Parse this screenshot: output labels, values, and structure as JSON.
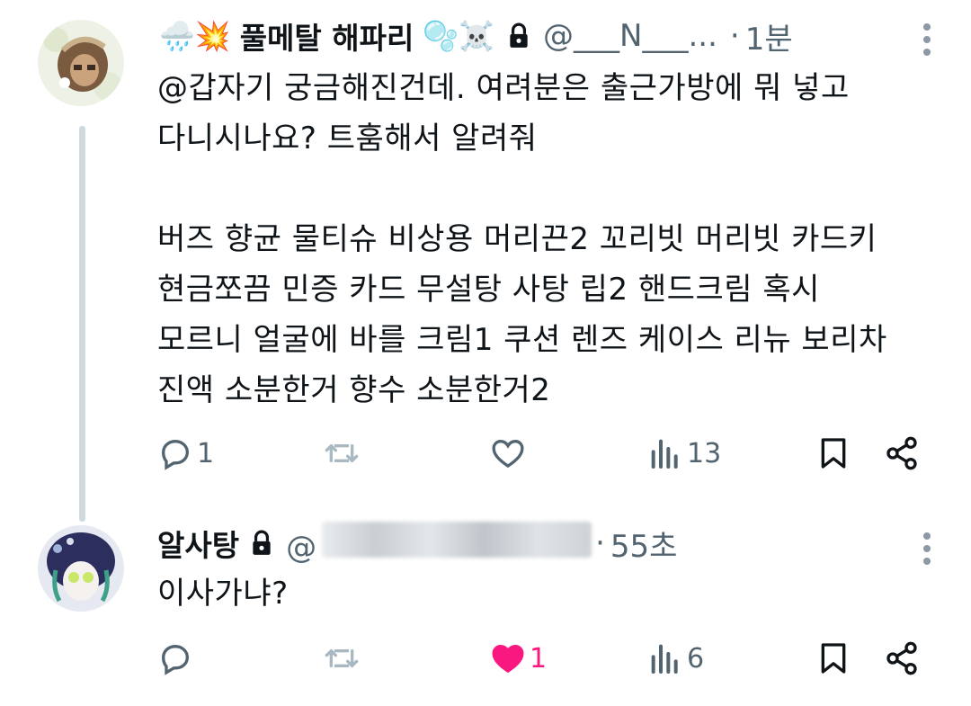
{
  "post1": {
    "display_name": "풀메탈 해파리",
    "emoji_left": "🌧️💥",
    "emoji_right": "🫧☠️",
    "handle": "@___N___...",
    "time": "1분",
    "text": "@갑자기 궁금해진건데. 여려분은 출근가방에 뭐 넣고\n다니시나요? 트훔해서 알려줘\n\n버즈 향균 물티슈 비상용 머리끈2 꼬리빗 머리빗 카드키\n현금쪼끔 민증 카드 무설탕 사탕 립2 핸드크림 혹시\n모르니 얼굴에 바를 크림1 쿠션 렌즈 케이스 리뉴 보리차\n진액 소분한거 향수 소분한거2",
    "replies": "1",
    "reposts": "",
    "likes": "",
    "views": "13"
  },
  "post2": {
    "display_name": "알사탕",
    "handle": "",
    "time": "55초",
    "text": "이사가냐?",
    "replies": "",
    "reposts": "",
    "likes": "1",
    "views": "6"
  },
  "colors": {
    "text": "#0f1419",
    "secondary": "#536471",
    "icon": "#536471",
    "thread_line": "#cfd9de",
    "like_active": "#f91880"
  },
  "icons": [
    "lock-icon",
    "more-icon",
    "reply-icon",
    "repost-icon",
    "like-icon",
    "views-icon",
    "bookmark-icon",
    "share-icon"
  ]
}
